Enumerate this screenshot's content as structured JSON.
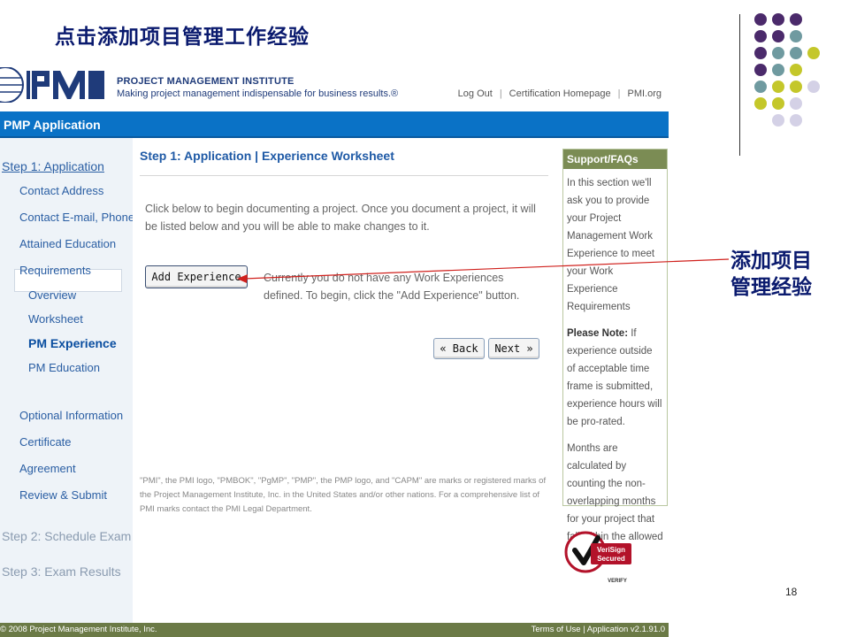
{
  "slide": {
    "title": "点击添加项目管理工作经验",
    "callout_line1": "添加项目",
    "callout_line2": "管理经验",
    "page_number": "18"
  },
  "header": {
    "org_name": "PROJECT MANAGEMENT INSTITUTE",
    "tagline": "Making project management indispensable for business results.®",
    "links": [
      "Log Out",
      "Certification Homepage",
      "PMI.org"
    ]
  },
  "appbar": {
    "title": "PMP Application"
  },
  "sidebar": {
    "step1": "Step 1: Application",
    "items": [
      "Contact Address",
      "Contact E-mail, Phone",
      "Attained Education",
      "Requirements"
    ],
    "sub_items": [
      "Overview",
      "Worksheet",
      "PM Experience",
      "PM Education"
    ],
    "items2": [
      "Optional Information",
      "Certificate",
      "Agreement",
      "Review & Submit"
    ],
    "step2": "Step 2: Schedule Exam",
    "step3": "Step 3: Exam Results"
  },
  "main": {
    "title": "Step 1: Application | Experience Worksheet",
    "intro": "Click below to begin documenting a project. Once you document a project, it will be listed below and you will be able to make changes to it.",
    "add_button": "Add Experience",
    "no_experience": "Currently you do not have any Work Experiences defined. To begin, click the \"Add Experience\" button.",
    "back_button": "« Back",
    "next_button": "Next »",
    "legal": "\"PMI\", the PMI logo, \"PMBOK\", \"PgMP\", \"PMP\", the PMP logo, and \"CAPM\" are marks or registered marks of the Project Management Institute, Inc. in the United States and/or other nations. For a comprehensive list of PMI marks contact the PMI Legal Department."
  },
  "support": {
    "title": "Support/FAQs",
    "para1": "In this section we'll ask you to provide your Project Management Work Experience to meet your Work Experience Requirements",
    "note_label": "Please Note:",
    "para2": " If experience outside of acceptable time frame is submitted, experience hours will be pro-rated.",
    "para3": "Months are calculated by counting the non-overlapping months for your project that fall within the allowed time period."
  },
  "verisign": {
    "line1": "VeriSign",
    "line2": "Secured",
    "line3": "VERIFY"
  },
  "footer": {
    "copyright": "© 2008 Project Management Institute, Inc.",
    "terms": "Terms of Use",
    "version": "Application v2.1.91.0"
  },
  "colors": {
    "dot_purple": "#4b2a6b",
    "dot_teal": "#6f9aa0",
    "dot_lime": "#c4c72a",
    "dot_lavender": "#d4d1e6",
    "appbar_blue": "#0a72c6",
    "footer_olive": "#6b7a46",
    "arrow_red": "#d0201c"
  }
}
